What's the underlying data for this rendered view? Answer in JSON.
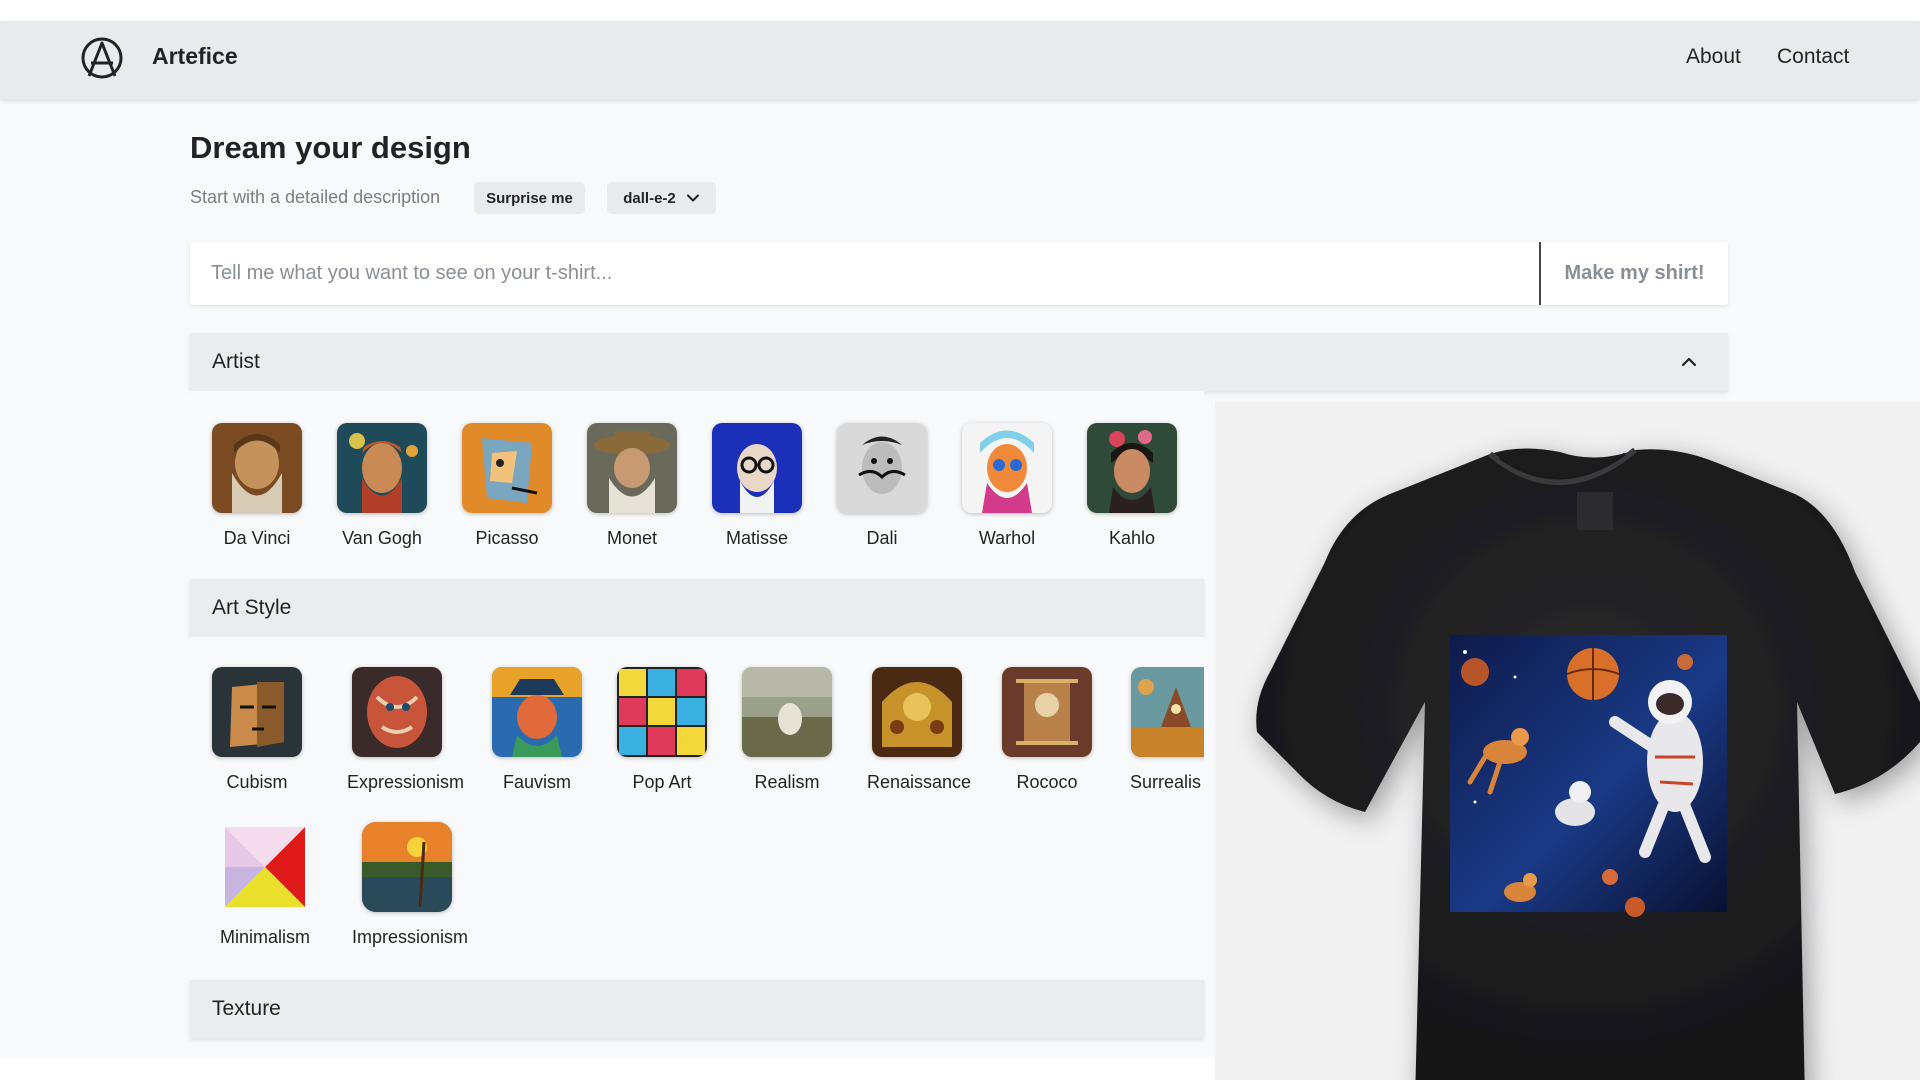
{
  "navbar": {
    "brand": "Artefice",
    "links": [
      "About",
      "Contact"
    ]
  },
  "hero": {
    "title": "Dream your design",
    "subtitle": "Start with a detailed description",
    "surprise_label": "Surprise me",
    "model_label": "dall-e-2"
  },
  "prompt": {
    "placeholder": "Tell me what you want to see on your t-shirt...",
    "button_label": "Make my shirt!"
  },
  "sections": {
    "artist": "Artist",
    "art_style": "Art Style",
    "texture": "Texture"
  },
  "artists": [
    "Da Vinci",
    "Van Gogh",
    "Picasso",
    "Monet",
    "Matisse",
    "Dali",
    "Warhol",
    "Kahlo"
  ],
  "styles": [
    "Cubism",
    "Expressionism",
    "Fauvism",
    "Pop Art",
    "Realism",
    "Renaissance",
    "Rococo",
    "Surrealis",
    "Minimalism",
    "Impressionism"
  ],
  "icons": {
    "logo": "anarchy-a-logo-icon",
    "model_dropdown": "chevron-down-icon",
    "artist_collapse": "chevron-up-icon"
  },
  "colors": {
    "navbar": "#e9eaec",
    "page": "#f8f9fa",
    "section_header": "#ebecee",
    "shirt": "#1c1c1e"
  }
}
